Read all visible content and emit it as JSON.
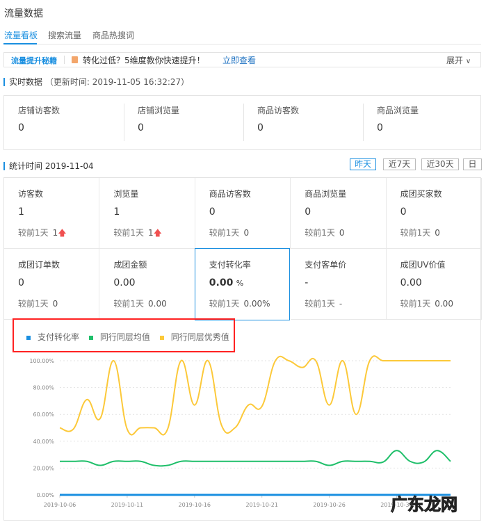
{
  "title": "流量数据",
  "tabs": [
    {
      "label": "流量看板",
      "active": true
    },
    {
      "label": "搜索流量"
    },
    {
      "label": "商品热搜词"
    }
  ],
  "banner": {
    "tag": "流量提升秘籍",
    "text": "转化过低？5维度教你快速提升！",
    "link": "立即查看",
    "expand": "展开",
    "expand_icon": "chevron-down-icon"
  },
  "realtime": {
    "title": "实时数据",
    "update": "（更新时间: 2019-11-05 16:32:27）",
    "items": [
      {
        "label": "店铺访客数",
        "value": "0"
      },
      {
        "label": "店铺浏览量",
        "value": "0"
      },
      {
        "label": "商品访客数",
        "value": "0"
      },
      {
        "label": "商品浏览量",
        "value": "0"
      }
    ]
  },
  "stats": {
    "title": "统计时间",
    "date": "2019-11-04",
    "ranges": [
      {
        "label": "昨天",
        "active": true
      },
      {
        "label": "近7天"
      },
      {
        "label": "近30天"
      },
      {
        "label": "日"
      }
    ],
    "compare_label": "较前1天",
    "items": [
      {
        "label": "访客数",
        "value": "1",
        "delta": "1",
        "up": true
      },
      {
        "label": "浏览量",
        "value": "1",
        "delta": "1",
        "up": true
      },
      {
        "label": "商品访客数",
        "value": "0",
        "delta": "0"
      },
      {
        "label": "商品浏览量",
        "value": "0",
        "delta": "0"
      },
      {
        "label": "成团买家数",
        "value": "0",
        "delta": "0"
      },
      {
        "label": "成团订单数",
        "value": "0",
        "delta": "0"
      },
      {
        "label": "成团金额",
        "value": "0.00",
        "delta": "0.00"
      },
      {
        "label": "支付转化率",
        "value": "0.00",
        "unit": "%",
        "delta": "0.00%",
        "selected": true
      },
      {
        "label": "支付客单价",
        "value": "-",
        "delta": "-"
      },
      {
        "label": "成团UV价值",
        "value": "0.00",
        "delta": "0.00"
      }
    ]
  },
  "chart_data": {
    "type": "line",
    "legend_position": "top-left",
    "grid": true,
    "ylim": [
      0,
      100
    ],
    "yticks": [
      "0.00%",
      "20.00%",
      "40.00%",
      "60.00%",
      "80.00%",
      "100.00%"
    ],
    "xticks": [
      "2019-10-06",
      "2019-10-11",
      "2019-10-16",
      "2019-10-21",
      "2019-10-26",
      "2019-10-31"
    ],
    "x_start": "2019-10-06",
    "x_end": "2019-11-04",
    "series": [
      {
        "name": "支付转化率",
        "color": "#1a8fe0",
        "values": [
          0,
          0,
          0,
          0,
          0,
          0,
          0,
          0,
          0,
          0,
          0,
          0,
          0,
          0,
          0,
          0,
          0,
          0,
          0,
          0,
          0,
          0,
          0,
          0,
          0,
          0,
          0,
          0,
          0,
          0
        ]
      },
      {
        "name": "同行同层均值",
        "color": "#1fbf6a",
        "values": [
          25,
          25,
          25,
          22,
          25,
          25,
          25,
          22,
          22,
          25,
          25,
          25,
          25,
          25,
          25,
          25,
          25,
          25,
          25,
          25,
          22,
          25,
          25,
          25,
          24.5,
          33,
          25,
          24.5,
          33,
          25
        ]
      },
      {
        "name": "同行同层优秀值",
        "color": "#fcc93a",
        "values": [
          50,
          49,
          71,
          57,
          100,
          49,
          50,
          50,
          49,
          100,
          67,
          100,
          52,
          50,
          67,
          66,
          100,
          100,
          95,
          100,
          67,
          100,
          60,
          100,
          100,
          100,
          100,
          100,
          100,
          100
        ]
      }
    ]
  },
  "watermark": "广东龙网"
}
